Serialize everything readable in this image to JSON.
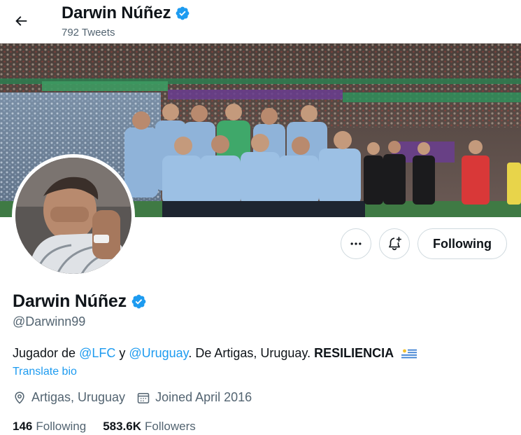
{
  "header": {
    "name": "Darwin Núñez",
    "tweet_count": "792 Tweets"
  },
  "profile": {
    "name": "Darwin Núñez",
    "handle": "@Darwinn99",
    "bio": {
      "prefix": "Jugador de ",
      "link1": "@LFC",
      "mid": " y ",
      "link2": "@Uruguay",
      "suffix": ". De Artigas, Uruguay. ",
      "bold": "RESILIENCIA"
    },
    "translate_label": "Translate bio",
    "location": "Artigas, Uruguay",
    "joined": "Joined April 2016"
  },
  "actions": {
    "follow_label": "Following"
  },
  "stats": {
    "following_count": "146",
    "following_label": "Following",
    "followers_count": "583.6K",
    "followers_label": "Followers"
  },
  "icons": {
    "back": "arrow-left-icon",
    "verified": "verified-badge-icon",
    "more": "more-icon",
    "notify": "bell-plus-icon",
    "location": "location-pin-icon",
    "calendar": "calendar-icon",
    "flag": "uruguay-flag-icon"
  },
  "colors": {
    "accent": "#1d9bf0",
    "text_primary": "#0f1419",
    "text_secondary": "#536471",
    "border": "#cfd9de"
  }
}
